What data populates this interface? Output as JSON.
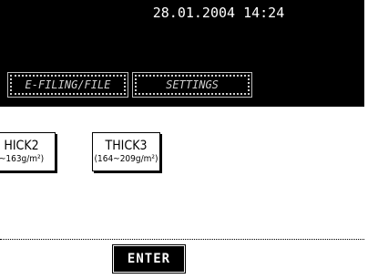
{
  "header": {
    "datetime": "28.01.2004 14:24"
  },
  "tabs": [
    {
      "label": "E-FILING/FILE"
    },
    {
      "label": "SETTINGS"
    }
  ],
  "paper_types": [
    {
      "name": "HICK2",
      "range": "~163g/m²)"
    },
    {
      "name": "THICK3",
      "range": "(164~209g/m²)"
    }
  ],
  "footer": {
    "enter_label": "ENTER"
  }
}
